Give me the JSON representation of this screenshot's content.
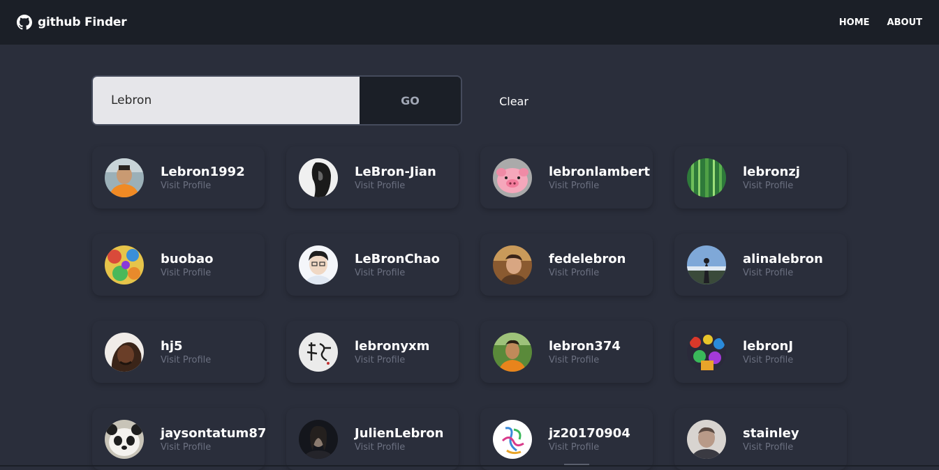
{
  "navbar": {
    "brand": "github Finder",
    "brand_icon": "github-icon",
    "links": [
      {
        "label": "HOME"
      },
      {
        "label": "ABOUT"
      }
    ]
  },
  "search": {
    "value": "Lebron",
    "placeholder": "",
    "go_label": "GO",
    "clear_label": "Clear"
  },
  "results": [
    {
      "username": "Lebron1992",
      "link_label": "Visit Profile",
      "avatar": "photo-orange-shirt"
    },
    {
      "username": "LeBron-Jian",
      "link_label": "Visit Profile",
      "avatar": "bw-portrait"
    },
    {
      "username": "lebronlambert",
      "link_label": "Visit Profile",
      "avatar": "pink-pig"
    },
    {
      "username": "lebronzj",
      "link_label": "Visit Profile",
      "avatar": "bamboo-forest"
    },
    {
      "username": "buobao",
      "link_label": "Visit Profile",
      "avatar": "colorful-art"
    },
    {
      "username": "LeBronChao",
      "link_label": "Visit Profile",
      "avatar": "face-portrait"
    },
    {
      "username": "fedelebron",
      "link_label": "Visit Profile",
      "avatar": "warm-photo"
    },
    {
      "username": "alinalebron",
      "link_label": "Visit Profile",
      "avatar": "sky-silhouette"
    },
    {
      "username": "hj5",
      "link_label": "Visit Profile",
      "avatar": "dark-portrait"
    },
    {
      "username": "lebronyxm",
      "link_label": "Visit Profile",
      "avatar": "calligraphy"
    },
    {
      "username": "lebron374",
      "link_label": "Visit Profile",
      "avatar": "green-outdoor"
    },
    {
      "username": "lebronJ",
      "link_label": "Visit Profile",
      "avatar": "colorful-crowd"
    },
    {
      "username": "jaysontatum87",
      "link_label": "Visit Profile",
      "avatar": "panda"
    },
    {
      "username": "JulienLebron",
      "link_label": "Visit Profile",
      "avatar": "dark-figure"
    },
    {
      "username": "jz20170904",
      "link_label": "Visit Profile",
      "avatar": "ribbon-logo"
    },
    {
      "username": "stainley",
      "link_label": "Visit Profile",
      "avatar": "grey-portrait"
    }
  ]
}
